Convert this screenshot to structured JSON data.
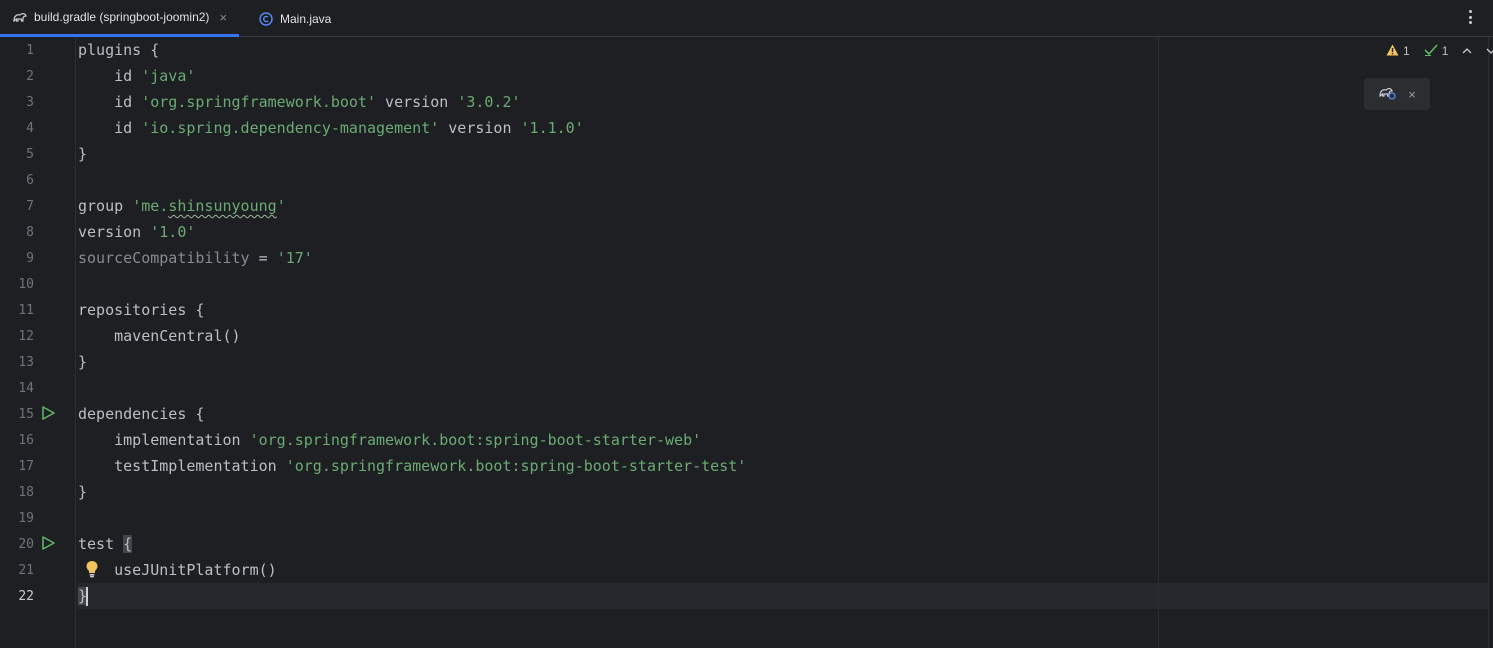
{
  "tabs": [
    {
      "label": "build.gradle (springboot-joomin2)",
      "icon": "gradle-elephant-icon",
      "active": true,
      "closable": true
    },
    {
      "label": "Main.java",
      "icon": "java-class-icon",
      "active": false,
      "closable": false
    }
  ],
  "tab_close_glyph": "×",
  "inspections": {
    "warnings": "1",
    "ok": "1"
  },
  "floating_toolbar": {
    "icon": "gradle-reload-icon",
    "close_glyph": "×"
  },
  "editor": {
    "line_numbers": [
      "1",
      "2",
      "3",
      "4",
      "5",
      "6",
      "7",
      "8",
      "9",
      "10",
      "11",
      "12",
      "13",
      "14",
      "15",
      "16",
      "17",
      "18",
      "19",
      "20",
      "21",
      "22"
    ],
    "current_line": "22",
    "run_gutter_lines": [
      "15",
      "20"
    ],
    "lines": {
      "l1": {
        "a": "plugins {"
      },
      "l2": {
        "a": "    id ",
        "s": "'java'"
      },
      "l3": {
        "a": "    id ",
        "s": "'org.springframework.boot'",
        "b": " version ",
        "t": "'3.0.2'"
      },
      "l4": {
        "a": "    id ",
        "s": "'io.spring.dependency-management'",
        "b": " version ",
        "t": "'1.1.0'"
      },
      "l5": {
        "a": "}"
      },
      "l7": {
        "a": "group ",
        "s1": "'me.",
        "sq": "shinsunyoung",
        "s2": "'"
      },
      "l8": {
        "a": "version ",
        "s": "'1.0'"
      },
      "l9": {
        "d": "sourceCompatibility",
        "a": " = ",
        "s": "'17'"
      },
      "l11": {
        "a": "repositories {"
      },
      "l12": {
        "a": "    mavenCentral()"
      },
      "l13": {
        "a": "}"
      },
      "l15": {
        "a": "dependencies {"
      },
      "l16": {
        "a": "    implementation ",
        "s": "'org.springframework.boot:spring-boot-starter-web'"
      },
      "l17": {
        "a": "    testImplementation ",
        "s": "'org.springframework.boot:spring-boot-starter-test'"
      },
      "l18": {
        "a": "}"
      },
      "l20": {
        "a": "test ",
        "b": "{"
      },
      "l21": {
        "a": "    useJUnitPlatform()"
      },
      "l22": {
        "a": "}"
      }
    }
  },
  "colors": {
    "background": "#1e1f22",
    "string": "#6aab73",
    "accent": "#3574f0",
    "warning": "#f2c55c",
    "ok": "#5fb865"
  }
}
